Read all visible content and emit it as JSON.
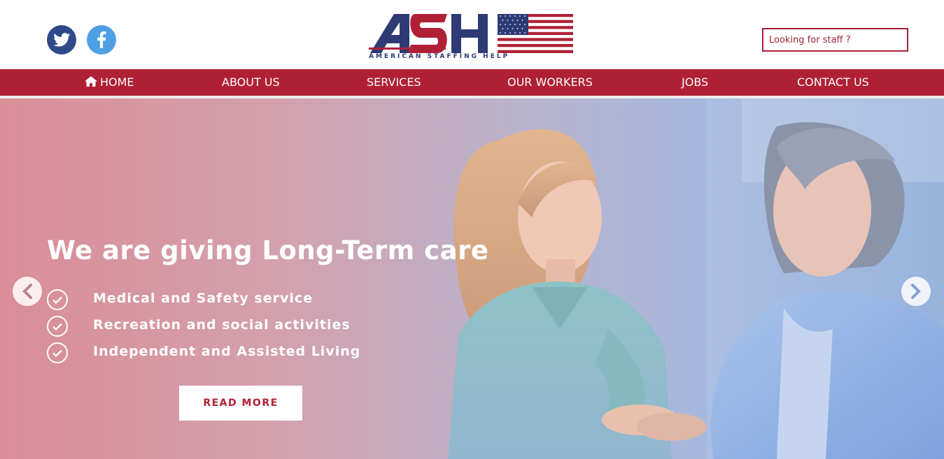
{
  "header": {
    "social": [
      {
        "name": "twitter",
        "icon": "twitter-icon"
      },
      {
        "name": "facebook",
        "icon": "facebook-icon"
      }
    ],
    "logo": {
      "mark": "ASH",
      "subtitle": "AMERICAN STAFFING HELP",
      "flag_icon": "us-flag-icon"
    },
    "search": {
      "placeholder": "Looking for staff ?",
      "value": ""
    }
  },
  "nav": {
    "items": [
      {
        "label": "HOME",
        "icon": "home-icon"
      },
      {
        "label": "ABOUT US"
      },
      {
        "label": "SERVICES"
      },
      {
        "label": "OUR WORKERS"
      },
      {
        "label": "JOBS"
      },
      {
        "label": "CONTACT US"
      }
    ]
  },
  "hero": {
    "title": "We are giving Long-Term care",
    "features": [
      {
        "text": "Medical and Safety service",
        "icon": "check-circle-icon"
      },
      {
        "text": "Recreation and social activities",
        "icon": "check-circle-icon"
      },
      {
        "text": "Independent and Assisted Living",
        "icon": "check-circle-icon"
      }
    ],
    "cta_label": "READ MORE",
    "prev_icon": "chevron-left-icon",
    "next_icon": "chevron-right-icon"
  },
  "colors": {
    "brand_red": "#b02035",
    "brand_navy": "#2d3a74",
    "twitter_bg": "#2f4a8a",
    "facebook_bg": "#4f9fe4",
    "white": "#ffffff"
  }
}
